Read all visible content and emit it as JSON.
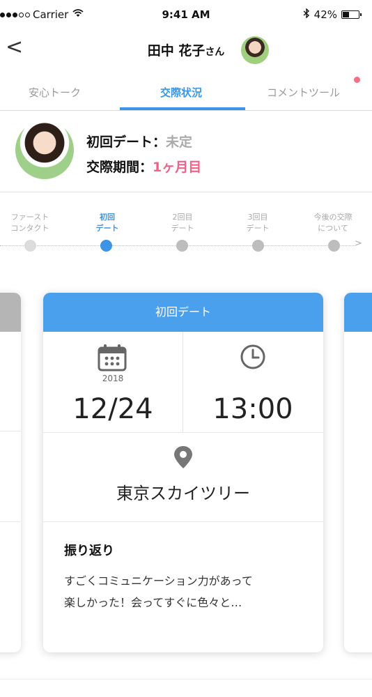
{
  "status_bar": {
    "carrier": "Carrier",
    "time": "9:41 AM",
    "battery": "42%"
  },
  "nav": {
    "back": "<",
    "name": "田中 花子",
    "suffix": "さん"
  },
  "tabs": [
    {
      "label": "安心トーク"
    },
    {
      "label": "交際状況"
    },
    {
      "label": "コメントツール"
    }
  ],
  "profile": {
    "first_date_label": "初回デート：",
    "first_date_value": "未定",
    "period_label": "交際期間：",
    "period_value": "1ヶ月目"
  },
  "steps": [
    {
      "line1": "ファースト",
      "line2": "コンタクト"
    },
    {
      "line1": "初回",
      "line2": "デート"
    },
    {
      "line1": "2回目",
      "line2": "デート"
    },
    {
      "line1": "3回目",
      "line2": "デート"
    },
    {
      "line1": "今後の交際",
      "line2": "について"
    }
  ],
  "card": {
    "title": "初回デート",
    "year": "2018",
    "date": "12/24",
    "time": "13:00",
    "place": "東京スカイツリー",
    "review_title": "振り返り",
    "review_line1": "すごくコミュニケーション力があって",
    "review_line2": "楽しかった！会ってすぐに色々と…"
  },
  "colors": {
    "accent": "#3b95e4",
    "card_header": "#4aa0ec",
    "pink": "#f0628a",
    "notice_dot": "#f36f83"
  }
}
